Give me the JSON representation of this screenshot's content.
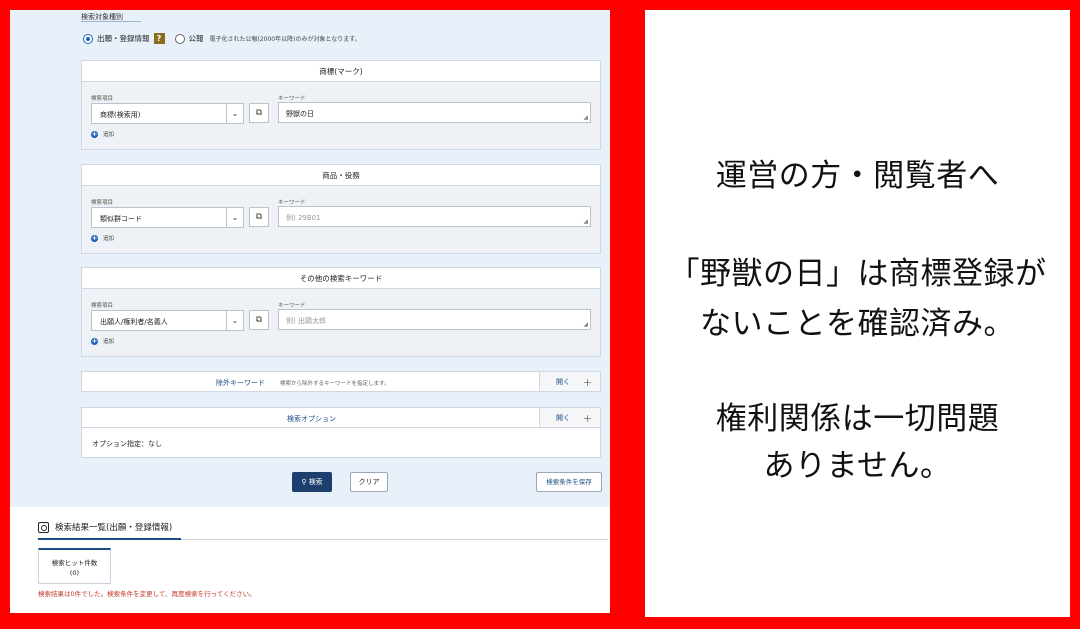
{
  "search": {
    "section_title": "検索対象種別",
    "radio_registered": "出願・登録情報",
    "help_mark": "?",
    "radio_gazette": "公報",
    "gazette_note": "電子化された公報(2000年以降)のみが対象となります。",
    "field_label": "検索項目",
    "keyword_label": "キーワード",
    "add_label": "追加",
    "sections": [
      {
        "title": "商標(マーク)",
        "select": "商標(検索用)",
        "keyword": "野獣の日",
        "keyword_is_placeholder": false
      },
      {
        "title": "商品・役務",
        "select": "類似群コード",
        "keyword": "例) 29B01",
        "keyword_is_placeholder": true
      },
      {
        "title": "その他の検索キーワード",
        "select": "出願人/権利者/名義人",
        "keyword": "例) 出願太郎",
        "keyword_is_placeholder": true
      }
    ],
    "exclude": {
      "title": "除外キーワード",
      "note": "検索から除外するキーワードを指定します。",
      "open": "開く",
      "plus": "＋"
    },
    "options": {
      "title": "検索オプション",
      "open": "開く",
      "plus": "＋",
      "body": "オプション指定：なし"
    },
    "buttons": {
      "search": "検索",
      "clear": "クリア",
      "save": "検索条件を保存"
    }
  },
  "results": {
    "title": "検索結果一覧(出願・登録情報)",
    "tab_label": "検索ヒット件数",
    "tab_count": "(0)",
    "error": "検索結果は0件でした。検索条件を変更して、再度検索を行ってください。"
  },
  "message": {
    "line1": "運営の方・閲覧者へ",
    "line2": "「野獣の日」は商標登録が",
    "line3": "ないことを確認済み。",
    "line4": "権利関係は一切問題",
    "line5": "ありません。"
  },
  "colors": {
    "frame": "#ff0000",
    "search_bg": "#e8f1fa",
    "primary": "#1c3f6e",
    "error": "#c0392b"
  }
}
